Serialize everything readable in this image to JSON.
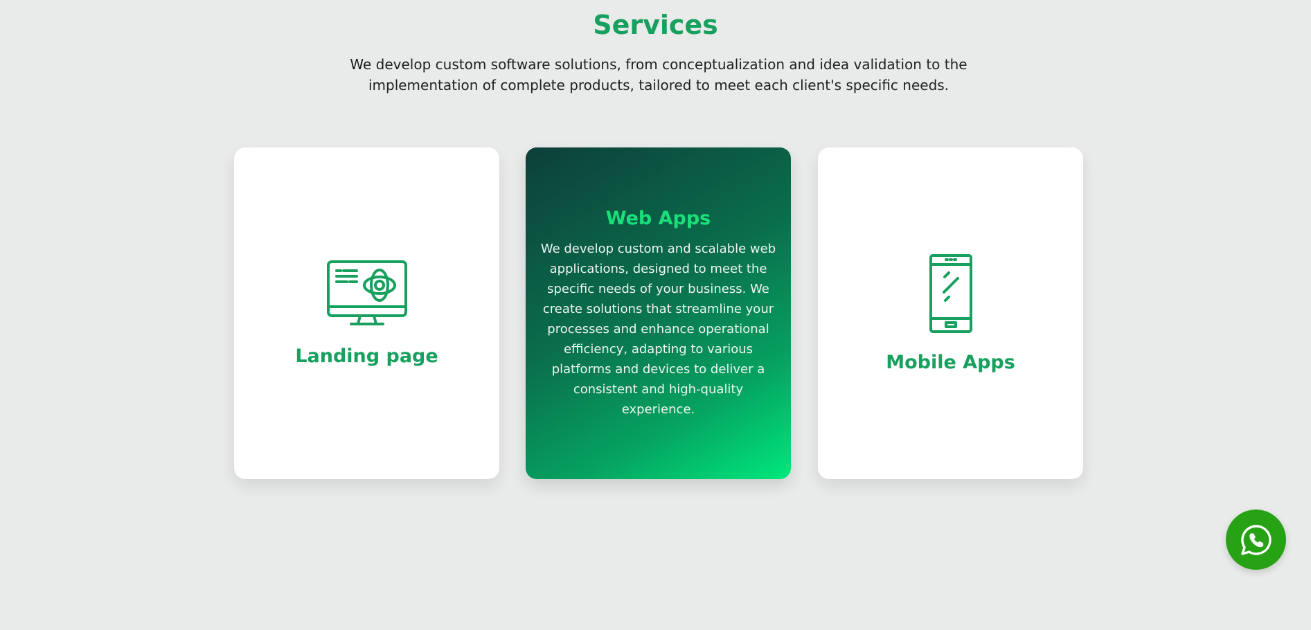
{
  "services": {
    "title": "Services",
    "subtitle": "We develop custom software solutions, from conceptualization and idea validation to the implementation of complete products, tailored to meet each client's specific needs.",
    "cards": [
      {
        "title": "Landing page",
        "icon": "monitor-target-icon"
      },
      {
        "title": "Web Apps",
        "description": "We develop custom and scalable web applications, designed to meet the specific needs of your business. We create solutions that streamline your processes and enhance operational efficiency, adapting to various platforms and devices to deliver a consistent and high-quality experience."
      },
      {
        "title": "Mobile Apps",
        "icon": "smartphone-icon"
      }
    ]
  },
  "floating": {
    "whatsapp_icon": "whatsapp-icon",
    "color": "#26a214"
  },
  "colors": {
    "accent": "#17a05e",
    "page_background": "#e9eaea",
    "card_background": "#ffffff",
    "highlight_gradient_start": "#0d3f3a",
    "highlight_gradient_end": "#00e87c"
  }
}
